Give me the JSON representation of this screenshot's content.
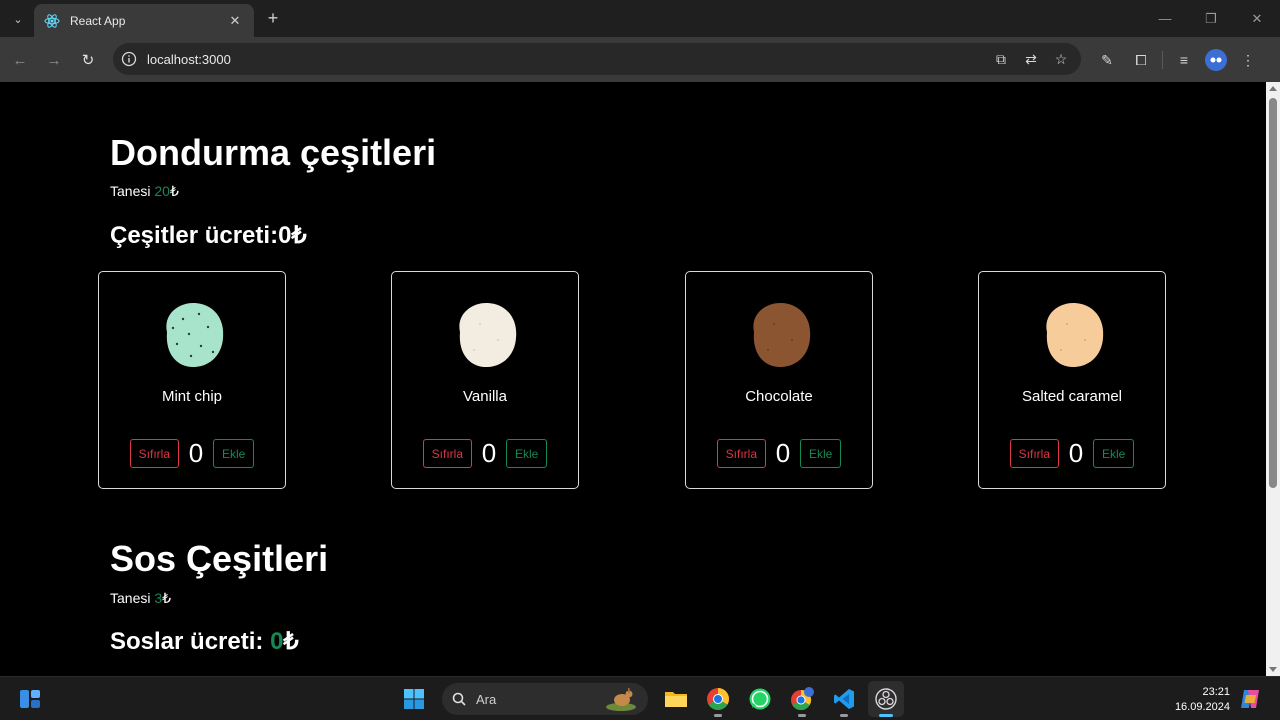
{
  "browser": {
    "tab_title": "React App",
    "url": "localhost:3000"
  },
  "page": {
    "icecream": {
      "title": "Dondurma çeşitleri",
      "unit_label": "Tanesi ",
      "unit_price": "20",
      "currency": "₺",
      "total_label": "Çeşitler ücreti:",
      "total_value": "0",
      "total_currency": "₺"
    },
    "flavors": [
      {
        "name": "Mint chip",
        "count": "0",
        "color": "#a8e4cc",
        "chip_color": "#2a3f34"
      },
      {
        "name": "Vanilla",
        "count": "0",
        "color": "#f3ece0",
        "chip_color": "#d6cdbf"
      },
      {
        "name": "Chocolate",
        "count": "0",
        "color": "#8a5530",
        "chip_color": "#6b3d1e"
      },
      {
        "name": "Salted caramel",
        "count": "0",
        "color": "#f6cc9a",
        "chip_color": "#e0a96b"
      }
    ],
    "buttons": {
      "reset": "Sıfırla",
      "add": "Ekle"
    },
    "sauce": {
      "title": "Sos Çeşitleri",
      "unit_label": "Tanesi ",
      "unit_price": "3",
      "currency": "₺",
      "total_label": "Soslar ücreti: ",
      "total_value": "0",
      "total_currency": "₺"
    }
  },
  "taskbar": {
    "search_label": "Ara",
    "time": "23:21",
    "date": "16.09.2024",
    "icons": [
      "widgets-icon",
      "windows-start-icon",
      "file-explorer-icon",
      "chrome-icon",
      "whatsapp-icon",
      "chrome-profile-icon",
      "vscode-icon",
      "obs-icon",
      "copilot-icon"
    ]
  },
  "colors": {
    "success": "#198754",
    "danger": "#dc3545",
    "page_bg": "#000000"
  }
}
